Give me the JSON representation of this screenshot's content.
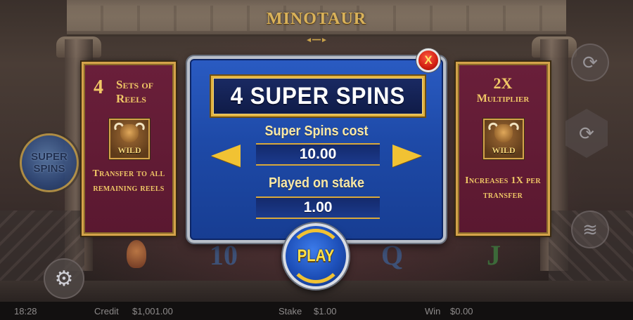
{
  "game": {
    "logo": "MINOTAUR"
  },
  "left_panel": {
    "head_number": "4",
    "head_text": "Sets of Reels",
    "wild_label": "WILD",
    "body": "Transfer to all remaining reels"
  },
  "right_panel": {
    "head_multiplier": "2X",
    "head_text": "Multiplier",
    "wild_label": "WILD",
    "body": "Increases 1X per transfer"
  },
  "dialog": {
    "title": "4 SUPER SPINS",
    "cost_label": "Super Spins cost",
    "cost_value": "10.00",
    "stake_label": "Played on stake",
    "stake_value": "1.00",
    "close_label": "X",
    "play_label": "PLAY"
  },
  "side_controls": {
    "super_spins_line1": "SUPER",
    "super_spins_line2": "SPINS"
  },
  "reels": {
    "symbols": [
      "10",
      "Q",
      "J"
    ]
  },
  "status_bar": {
    "time": "18:28",
    "credit_label": "Credit",
    "credit_value": "$1,001.00",
    "stake_label": "Stake",
    "stake_value": "$1.00",
    "win_label": "Win",
    "win_value": "$0.00"
  },
  "colors": {
    "panel_maroon": "#6a1f3a",
    "gold": "#d4a34a",
    "dialog_blue": "#1e4aa8",
    "close_red": "#d01f10",
    "arrow_yellow": "#f1c233"
  }
}
